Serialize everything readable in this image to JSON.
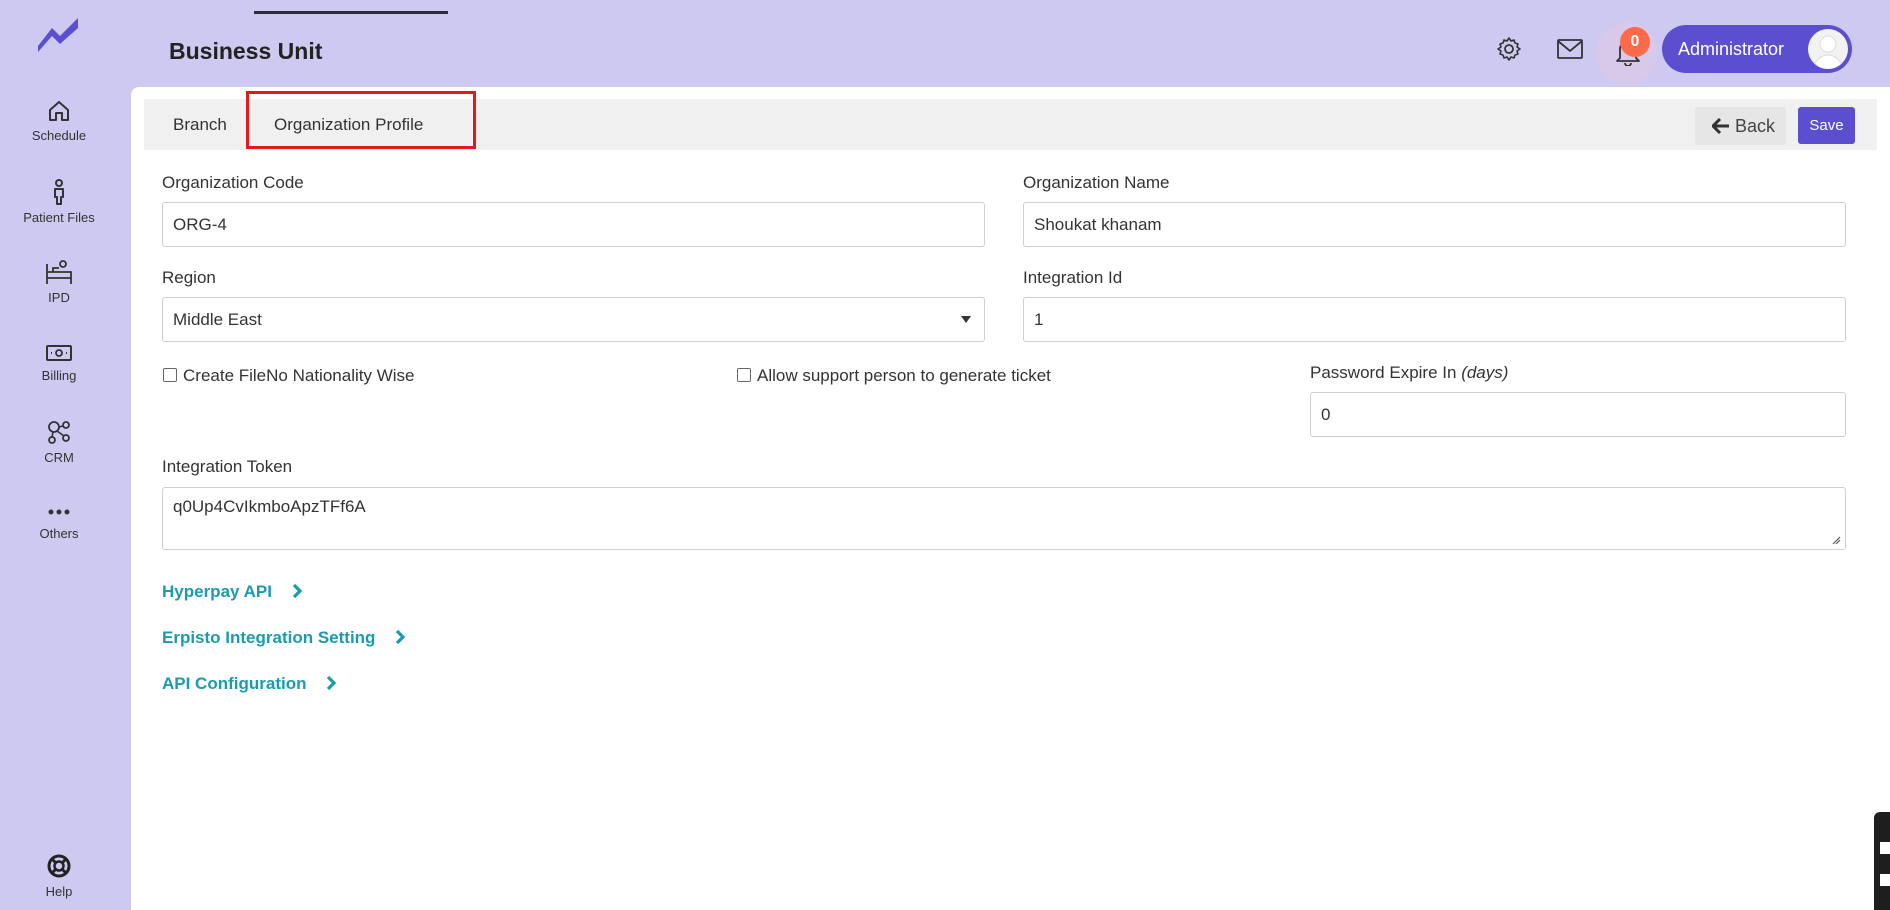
{
  "app": {
    "title": "Business Unit"
  },
  "sidebar": {
    "items": [
      {
        "label": "Schedule",
        "icon": "home-icon"
      },
      {
        "label": "Patient Files",
        "icon": "person-icon"
      },
      {
        "label": "IPD",
        "icon": "bed-icon"
      },
      {
        "label": "Billing",
        "icon": "cash-icon"
      },
      {
        "label": "CRM",
        "icon": "network-icon"
      },
      {
        "label": "Others",
        "icon": "more-icon"
      }
    ],
    "help": {
      "label": "Help",
      "icon": "lifebuoy-icon"
    }
  },
  "header": {
    "notifications_count": "0",
    "user_label": "Administrator"
  },
  "tabs": [
    {
      "label": "Branch",
      "active": false
    },
    {
      "label": "Organization Profile",
      "active": true
    }
  ],
  "toolbar": {
    "back_label": "Back",
    "save_label": "Save"
  },
  "form": {
    "org_code": {
      "label": "Organization Code",
      "value": "ORG-4"
    },
    "org_name": {
      "label": "Organization Name",
      "value": "Shoukat khanam"
    },
    "region": {
      "label": "Region",
      "value": "Middle East"
    },
    "integration_id": {
      "label": "Integration Id",
      "value": "1"
    },
    "create_fileno": {
      "label": "Create FileNo Nationality Wise",
      "checked": false
    },
    "allow_support": {
      "label": "Allow support person to generate ticket",
      "checked": false
    },
    "password_expire": {
      "label": "Password Expire In",
      "label_unit": "(days)",
      "value": "0"
    },
    "integration_token": {
      "label": "Integration Token",
      "value": "q0Up4CvIkmboApzTFf6A"
    }
  },
  "sections": [
    {
      "label": "Hyperpay API"
    },
    {
      "label": "Erpisto Integration Setting"
    },
    {
      "label": "API Configuration"
    }
  ],
  "colors": {
    "background": "#cdc9f0",
    "accent": "#5b4fd0",
    "link": "#1a9bb0",
    "badge": "#ff6b4a",
    "highlight": "#e01b1b"
  }
}
